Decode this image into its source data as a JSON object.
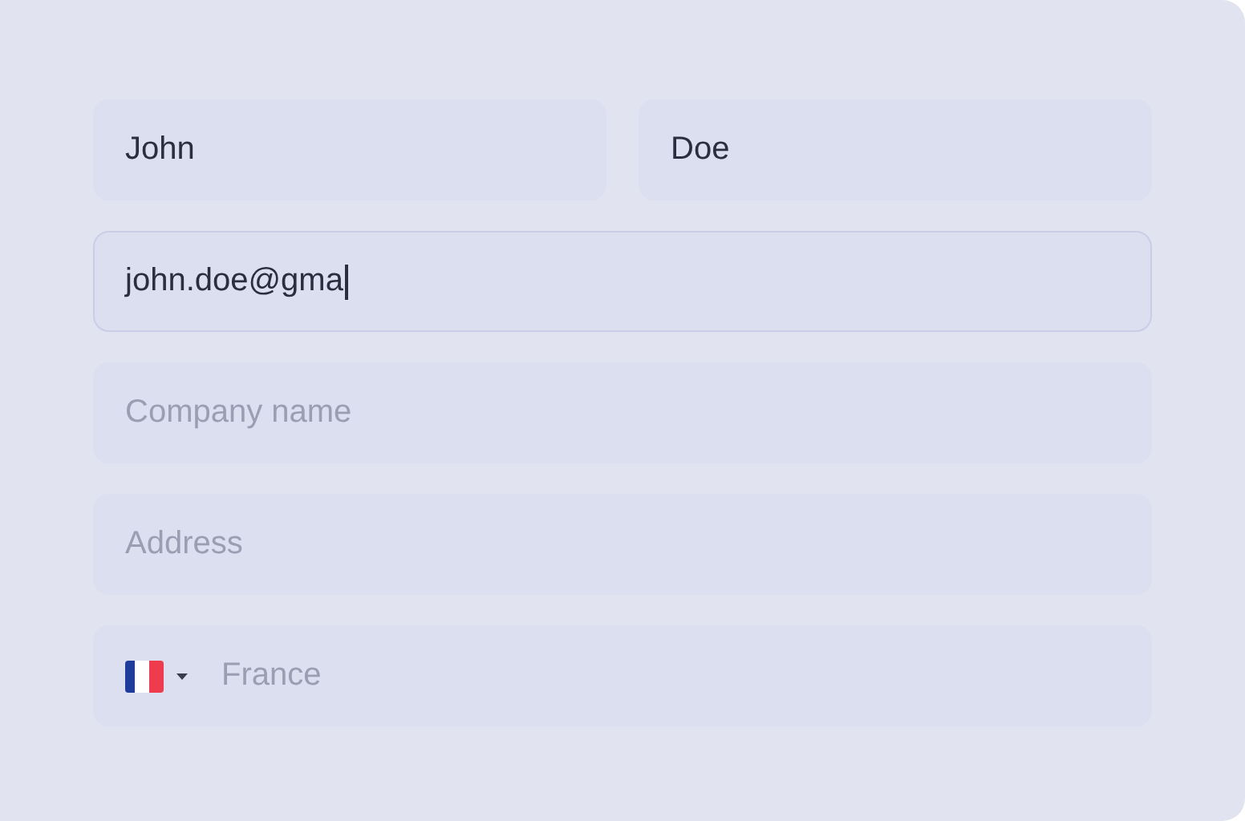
{
  "name_row": [
    {
      "value": "John"
    },
    {
      "value": "Doe"
    }
  ],
  "fields": [
    {
      "kind": "text",
      "value": "john.doe@gma",
      "focused": true
    },
    {
      "kind": "text",
      "placeholder": "Company name",
      "focused": false
    },
    {
      "kind": "text",
      "placeholder": "Address",
      "focused": false
    },
    {
      "kind": "country",
      "placeholder": "France",
      "focused": false
    }
  ]
}
